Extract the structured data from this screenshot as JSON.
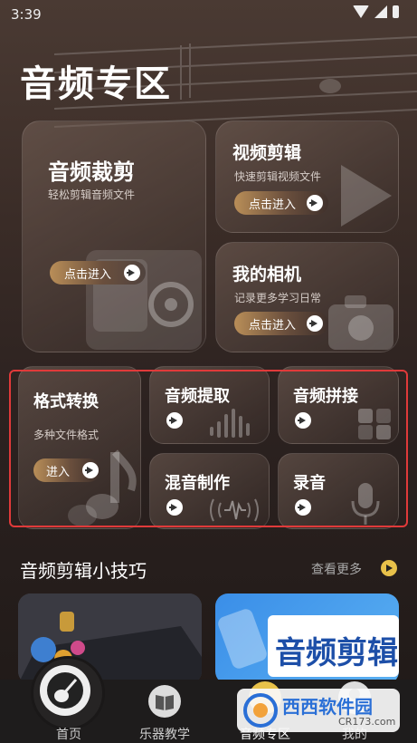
{
  "status_bar": {
    "time": "3:39"
  },
  "page_title": "音频专区",
  "cards": {
    "audio_cut": {
      "title": "音频裁剪",
      "subtitle": "轻松剪辑音频文件",
      "button": "点击进入"
    },
    "video_edit": {
      "title": "视频剪辑",
      "subtitle": "快速剪辑视频文件",
      "button": "点击进入"
    },
    "camera": {
      "title": "我的相机",
      "subtitle": "记录更多学习日常",
      "button": "点击进入"
    },
    "format_convert": {
      "title": "格式转换",
      "subtitle": "多种文件格式",
      "button": "进入"
    },
    "audio_extract": {
      "title": "音频提取"
    },
    "audio_splice": {
      "title": "音频拼接"
    },
    "mix": {
      "title": "混音制作"
    },
    "record": {
      "title": "录音"
    }
  },
  "tips": {
    "title": "音频剪辑小技巧",
    "more": "查看更多",
    "thumb2_text": "音频剪辑"
  },
  "tabbar": {
    "items": [
      {
        "label": "首页",
        "icon": "guitar-icon"
      },
      {
        "label": "乐器教学",
        "icon": "book-icon"
      },
      {
        "label": "音频专区",
        "icon": "audio-zone-icon"
      },
      {
        "label": "我的",
        "icon": "profile-icon"
      }
    ]
  },
  "watermark": {
    "brand": "西西软件园",
    "url": "CR173.com"
  },
  "colors": {
    "accent_gold": "#e8c14a",
    "highlight_red": "#e03a3a"
  }
}
